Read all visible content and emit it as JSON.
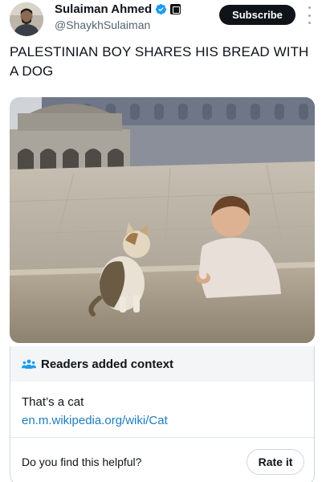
{
  "post": {
    "author_name": "Sulaiman Ahmed",
    "handle": "@ShaykhSulaiman",
    "subscribe_label": "Subscribe",
    "text": "PALESTINIAN BOY SHARES HIS BREAD WITH A DOG",
    "icons": [
      "verified-badge-icon",
      "affiliate-badge-icon",
      "more-options-icon"
    ],
    "accent_color": "#1d9bf0"
  },
  "note": {
    "title": "Readers added context",
    "icon": "people-icon",
    "text": "That’s a cat",
    "link": "en.m.wikipedia.org/wiki/Cat",
    "helpful_question": "Do you find this helpful?",
    "rate_label": "Rate it",
    "link_color": "#1d7dbb"
  }
}
